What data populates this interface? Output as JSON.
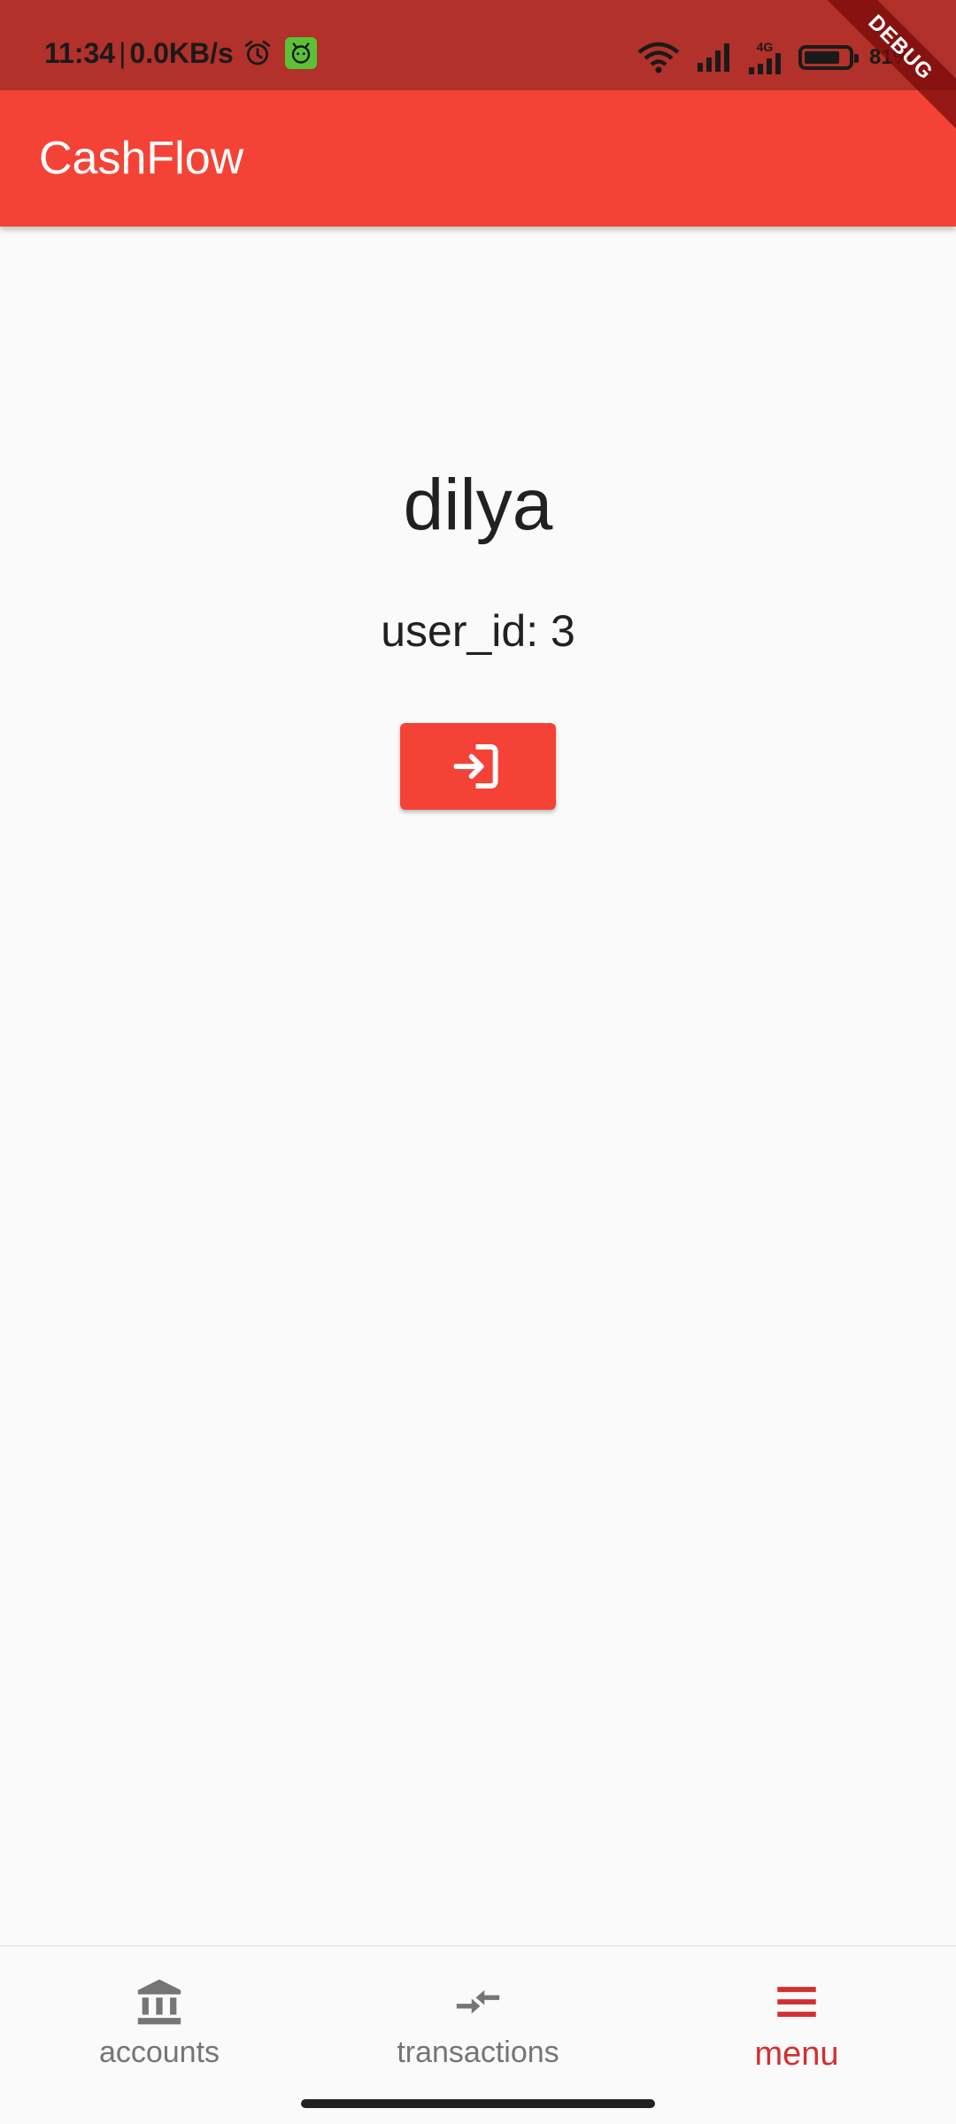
{
  "status_bar": {
    "time": "11:34",
    "separator": "|",
    "net_speed": "0.0KB/s",
    "network": "4G",
    "battery_pct": "81%",
    "battery_level": 0.81
  },
  "debug_banner": "DEBUG",
  "app_bar": {
    "title": "CashFlow"
  },
  "profile": {
    "username": "dilya",
    "user_id_text": "user_id: 3"
  },
  "bottom_nav": {
    "items": [
      {
        "label": "accounts",
        "icon": "bank-icon",
        "active": false
      },
      {
        "label": "transactions",
        "icon": "compare-arrows-icon",
        "active": false
      },
      {
        "label": "menu",
        "icon": "menu-icon",
        "active": true
      }
    ]
  },
  "colors": {
    "primary": "#F44336",
    "status_bar": "#B2312A",
    "active_nav": "#D32F2F",
    "inactive_nav": "#757575",
    "background": "#FAFAFA"
  }
}
